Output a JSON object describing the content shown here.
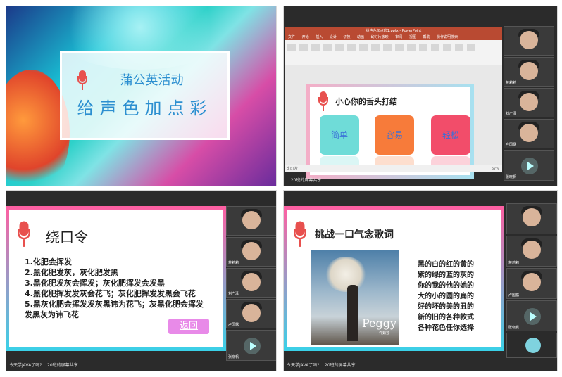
{
  "panel1": {
    "title": "蒲公英活动",
    "subtitle": "给声色加点彩"
  },
  "panel2": {
    "window_title": "给声色加点彩1.pptx - PowerPoint",
    "menu": [
      "文件",
      "开始",
      "插入",
      "设计",
      "切换",
      "动画",
      "幻灯片放映",
      "审阅",
      "视图",
      "帮助",
      "操作说明搜索"
    ],
    "slide_title": "小心你的舌头打结",
    "cards": [
      {
        "label": "简单",
        "color": "#6fdcd8",
        "text_color": "#3a6fd8"
      },
      {
        "label": "容易",
        "color": "#f77b3a",
        "text_color": "#3a6fd8"
      },
      {
        "label": "轻松",
        "color": "#f24d6a",
        "text_color": "#3a6fd8"
      }
    ],
    "status": "幻灯片",
    "zoom": "67%",
    "caption": "...20班的屏幕共享",
    "cams": [
      "",
      "蒋莉莉",
      "刘广泽",
      "卢国露",
      "张晓帆"
    ]
  },
  "panel3": {
    "title": "绕口令",
    "lines": [
      "1.化肥会挥发",
      "2.黑化肥发灰，灰化肥发黑",
      "3.黑化肥发灰会挥发；灰化肥挥发会发黑",
      "4.黑化肥挥发发灰会花飞；灰化肥挥发发黑会飞花",
      "5.黑灰化肥会挥发发灰黑讳为花飞；灰黑化肥会挥发发黑灰为讳飞花"
    ],
    "back_button": "返回",
    "caption": "今天学JAVA了吗?  ...20班的屏幕共享",
    "cams": [
      "",
      "蒋莉莉",
      "刘广泽",
      "卢国露",
      "张晓帆"
    ]
  },
  "panel4": {
    "title": "挑战一口气念歌词",
    "album_title": "Peggy",
    "album_sub": "许茹芸",
    "lyrics": [
      "黑的白的红的黄的",
      "紫的绿的蓝的灰的",
      "你的我的他的她的",
      "大的小的圆的扁的",
      "好的坏的美的丑的",
      "新的旧的各种款式",
      "各种花色任你选择"
    ],
    "caption": "今天学JAVA了吗?  ...20班的屏幕共享",
    "cams": [
      "",
      "蒋莉莉",
      "卢国露",
      "张晓帆"
    ]
  }
}
